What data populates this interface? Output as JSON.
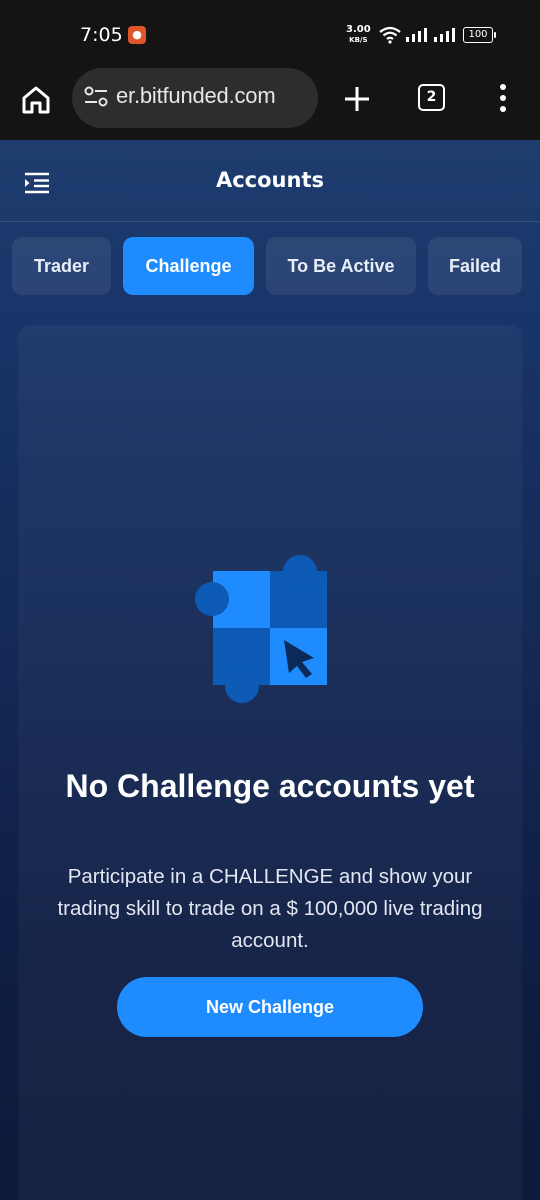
{
  "status_bar": {
    "time": "7:05",
    "net_speed": "3.00",
    "net_speed_unit": "KB/S",
    "battery": "100"
  },
  "browser": {
    "url": "er.bitfunded.com",
    "tab_count": "2"
  },
  "header": {
    "title": "Accounts"
  },
  "tabs": [
    {
      "label": "Trader",
      "active": false
    },
    {
      "label": "Challenge",
      "active": true
    },
    {
      "label": "To Be Active",
      "active": false
    },
    {
      "label": "Failed",
      "active": false
    }
  ],
  "empty_state": {
    "title": "No Challenge accounts yet",
    "description": "Participate in a CHALLENGE and show your trading skill to trade on a $ 100,000 live trading account.",
    "button_label": "New Challenge"
  },
  "colors": {
    "accent": "#1e8bff",
    "accent_dark": "#0d5bb5"
  }
}
